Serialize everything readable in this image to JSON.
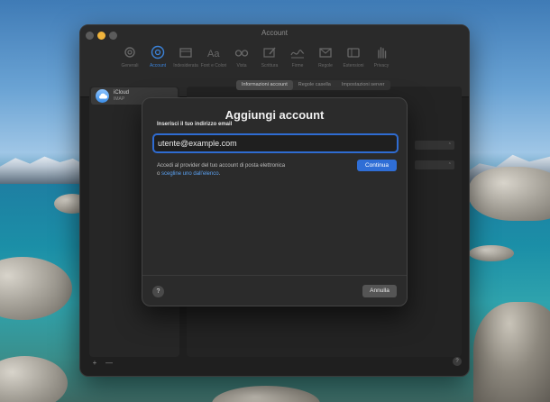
{
  "window": {
    "title": "Account"
  },
  "toolbar": {
    "items": [
      {
        "label": "Generali",
        "icon": "gear-icon"
      },
      {
        "label": "Account",
        "icon": "at-sign-icon"
      },
      {
        "label": "Indesiderata",
        "icon": "junk-mail-icon"
      },
      {
        "label": "Font e Colori",
        "icon": "font-icon"
      },
      {
        "label": "Vista",
        "icon": "glasses-icon"
      },
      {
        "label": "Scrittura",
        "icon": "pencil-icon"
      },
      {
        "label": "Firme",
        "icon": "signature-icon"
      },
      {
        "label": "Regole",
        "icon": "envelope-rules-icon"
      },
      {
        "label": "Estensioni",
        "icon": "puzzle-icon"
      },
      {
        "label": "Privacy",
        "icon": "hand-icon"
      }
    ],
    "active": "Account"
  },
  "sidebar": {
    "account": {
      "name": "iCloud",
      "type": "IMAP"
    },
    "add_label": "+",
    "remove_label": "—"
  },
  "detail": {
    "tabs": [
      "Informazioni account",
      "Regole casella",
      "Impostazioni server"
    ],
    "help_label": "?"
  },
  "dialog": {
    "title": "Aggiungi account",
    "prompt": "Inserisci il tuo indirizzo email",
    "email_placeholder": "utente@example.com",
    "info_line1": "Accedi al provider del tuo account di posta elettronica",
    "info_line2_prefix": "o ",
    "info_link": "scegline uno dall'elenco",
    "info_suffix": ".",
    "continue_label": "Continua",
    "help_label": "?",
    "cancel_label": "Annulla"
  },
  "colors": {
    "accent": "#2f6ed6",
    "link": "#5aa0f0",
    "window_bg": "#1f1f1f",
    "dialog_bg": "#2b2b2b"
  }
}
